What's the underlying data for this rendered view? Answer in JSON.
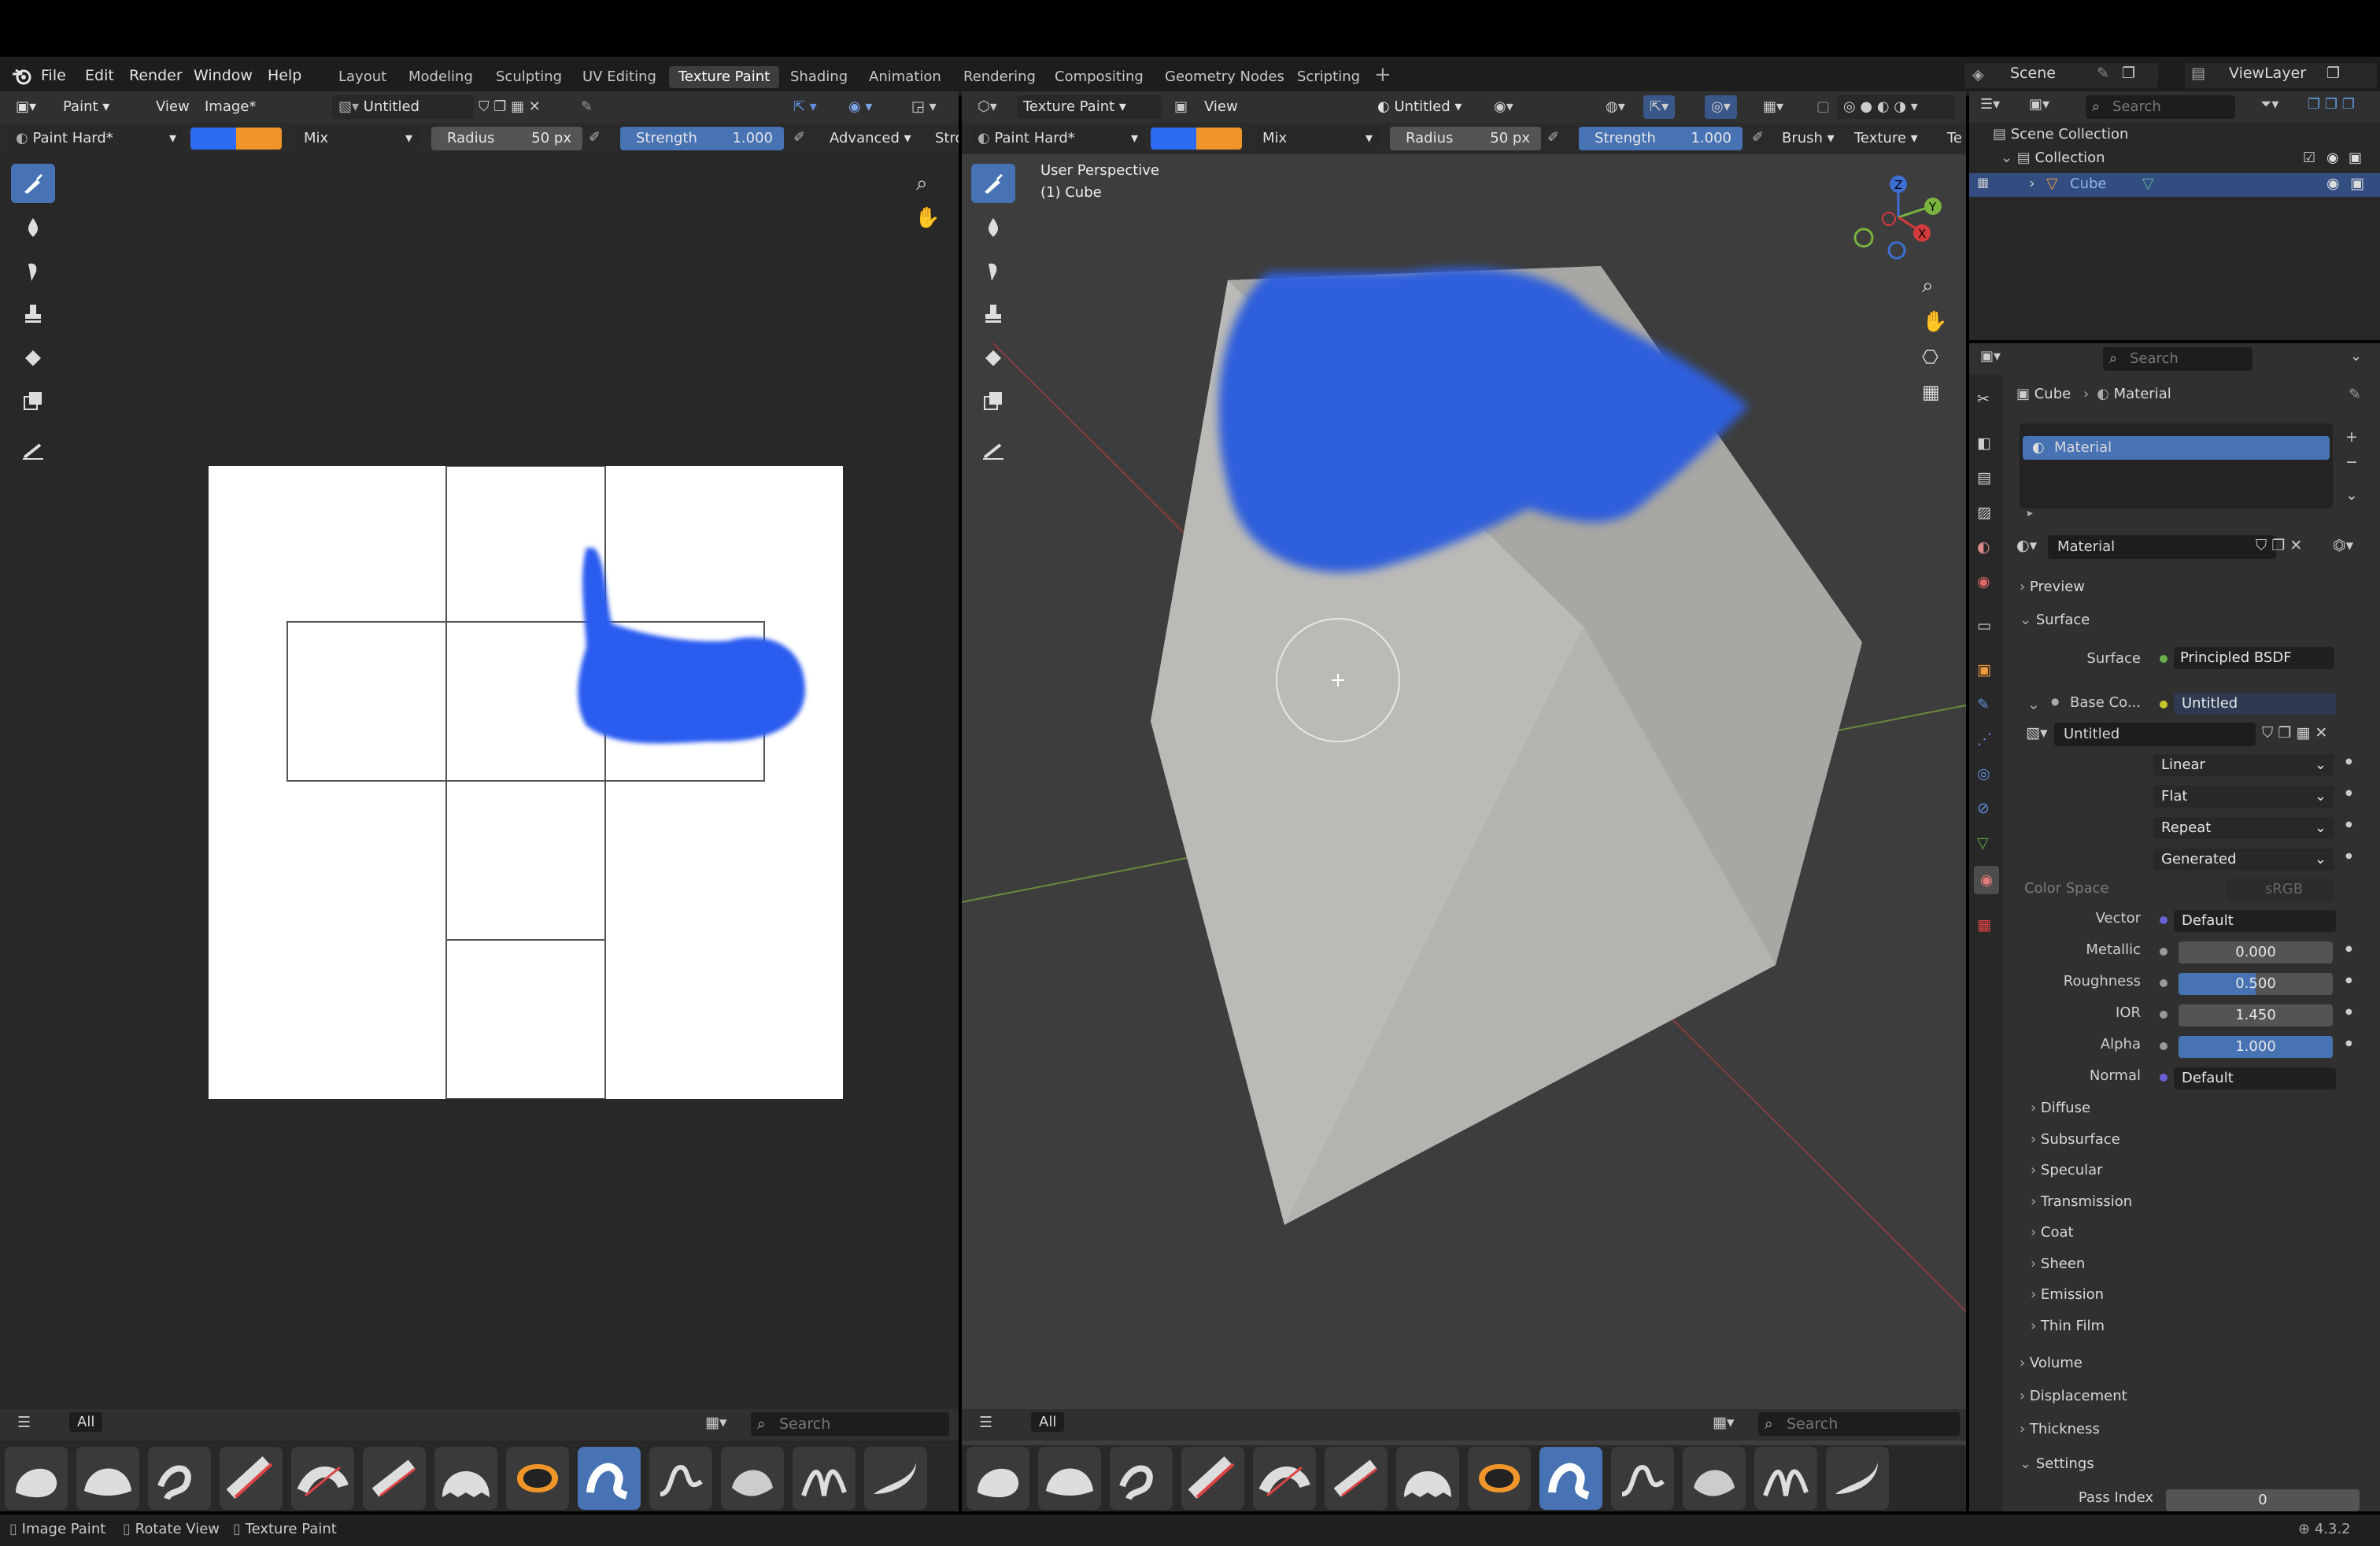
{
  "top_menu": {
    "file": "File",
    "edit": "Edit",
    "render": "Render",
    "window": "Window",
    "help": "Help"
  },
  "workspaces": [
    "Layout",
    "Modeling",
    "Sculpting",
    "UV Editing",
    "Texture Paint",
    "Shading",
    "Animation",
    "Rendering",
    "Compositing",
    "Geometry Nodes",
    "Scripting"
  ],
  "scene": {
    "name": "Scene",
    "view_layer": "ViewLayer"
  },
  "image_editor": {
    "mode": "Paint",
    "view": "View",
    "image_menu": "Image*",
    "image_name": "Untitled",
    "brush": "Paint Hard*",
    "blend": "Mix",
    "radius_label": "Radius",
    "radius_value": "50 px",
    "strength_label": "Strength",
    "strength_value": "1.000",
    "advanced": "Advanced",
    "stroke_cut": "Stro",
    "color1": "#2c6bf2",
    "color2": "#f0952a",
    "bottom_all": "All",
    "search_placeholder": "Search"
  },
  "viewport": {
    "mode": "Texture Paint",
    "view": "View",
    "shading": "Untitled",
    "brush": "Paint Hard*",
    "blend": "Mix",
    "radius_label": "Radius",
    "radius_value": "50 px",
    "strength_label": "Strength",
    "strength_value": "1.000",
    "brush_menu": "Brush",
    "texture_menu": "Texture",
    "tex_cut": "Te",
    "perspective": "User Perspective",
    "object_label": "(1) Cube",
    "bottom_all": "All",
    "search_placeholder": "Search"
  },
  "outliner": {
    "search_placeholder": "Search",
    "scene_collection": "Scene Collection",
    "collection": "Collection",
    "cube": "Cube"
  },
  "properties": {
    "search_placeholder": "Search",
    "breadcrumb_object": "Cube",
    "breadcrumb_material": "Material",
    "slot_material": "Material",
    "material_name": "Material",
    "preview": "Preview",
    "surface_section": "Surface",
    "surface_label": "Surface",
    "surface_value": "Principled BSDF",
    "base_color_label": "Base Co...",
    "base_color_value": "Untitled",
    "image_name": "Untitled",
    "interpolation": "Linear",
    "projection": "Flat",
    "extension": "Repeat",
    "source": "Generated",
    "color_space_label": "Color Space",
    "color_space_value": "sRGB",
    "vector_label": "Vector",
    "vector_value": "Default",
    "metallic_label": "Metallic",
    "metallic_value": "0.000",
    "roughness_label": "Roughness",
    "roughness_value": "0.500",
    "roughness_fraction": 0.5,
    "ior_label": "IOR",
    "ior_value": "1.450",
    "alpha_label": "Alpha",
    "alpha_value": "1.000",
    "alpha_fraction": 1.0,
    "normal_label": "Normal",
    "normal_value": "Default",
    "subpanels": [
      "Diffuse",
      "Subsurface",
      "Specular",
      "Transmission",
      "Coat",
      "Sheen",
      "Emission",
      "Thin Film"
    ],
    "volume": "Volume",
    "displacement": "Displacement",
    "thickness": "Thickness",
    "settings": "Settings",
    "pass_index_label": "Pass Index",
    "pass_index_value": "0"
  },
  "status_bar": {
    "image_paint": "Image Paint",
    "rotate_view": "Rotate View",
    "texture_paint": "Texture Paint",
    "version": "4.3.2"
  },
  "icons": [
    "blender-logo-icon",
    "paint-brush-icon",
    "soften-icon",
    "smear-icon",
    "clone-icon",
    "fill-icon",
    "mask-icon",
    "annotate-icon",
    "zoom-icon",
    "hand-icon",
    "camera-icon",
    "grid-icon",
    "eye-icon",
    "camera-toggle-icon",
    "search-icon",
    "filter-icon",
    "material-icon",
    "wrench-icon"
  ]
}
